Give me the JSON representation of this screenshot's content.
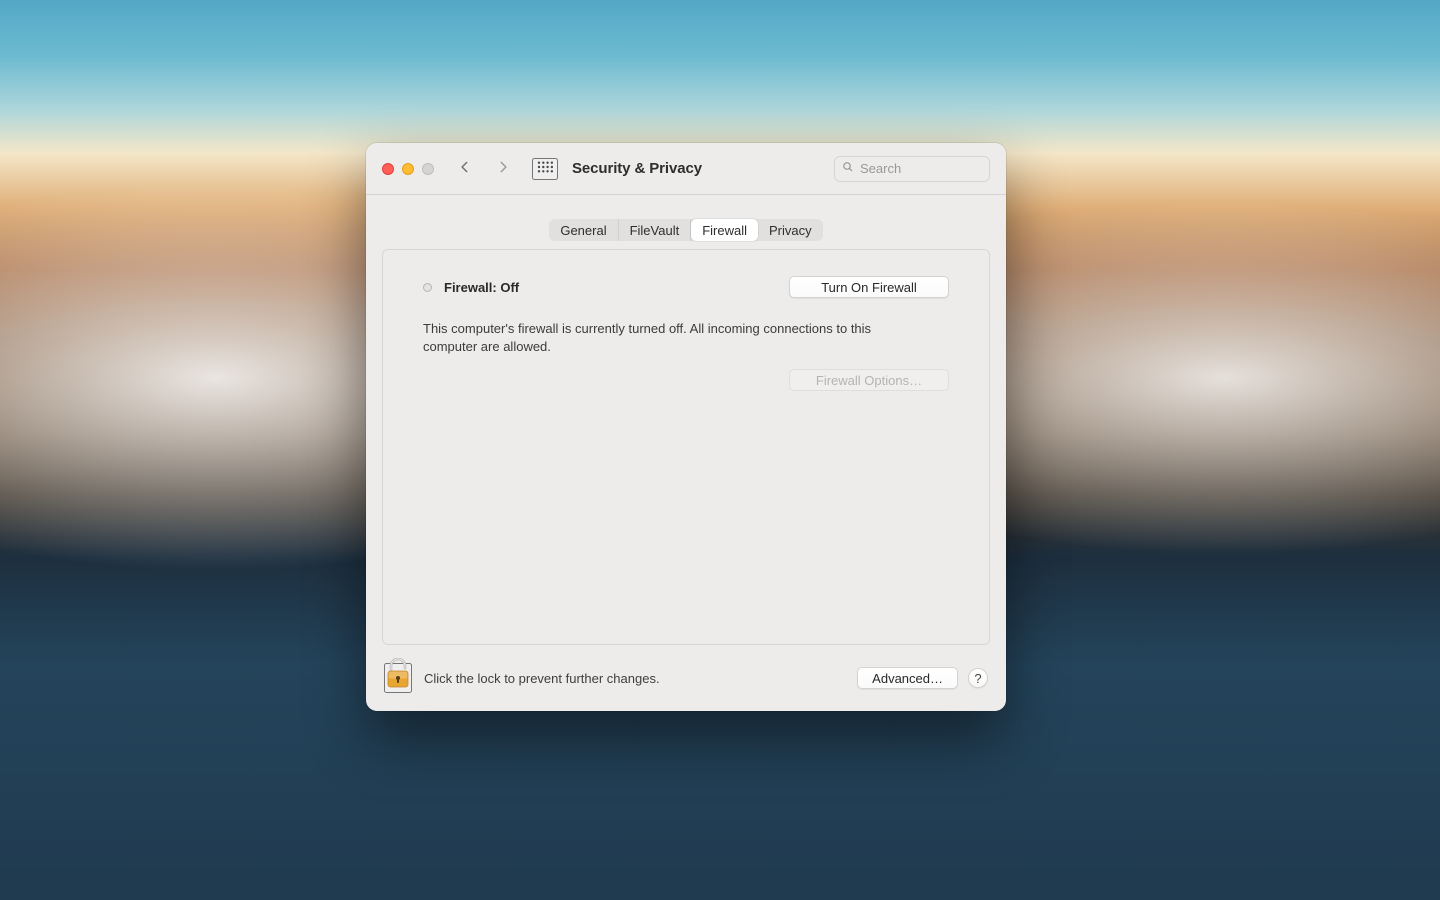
{
  "header": {
    "title": "Security & Privacy",
    "search_placeholder": "Search"
  },
  "tabs": {
    "general": "General",
    "filevault": "FileVault",
    "firewall": "Firewall",
    "privacy": "Privacy",
    "active": "firewall"
  },
  "firewall": {
    "status_label": "Firewall: Off",
    "turn_on_label": "Turn On Firewall",
    "description": "This computer's firewall is currently turned off. All incoming connections to this computer are allowed.",
    "options_label": "Firewall Options…"
  },
  "footer": {
    "lock_text": "Click the lock to prevent further changes.",
    "advanced_label": "Advanced…",
    "help_label": "?"
  }
}
